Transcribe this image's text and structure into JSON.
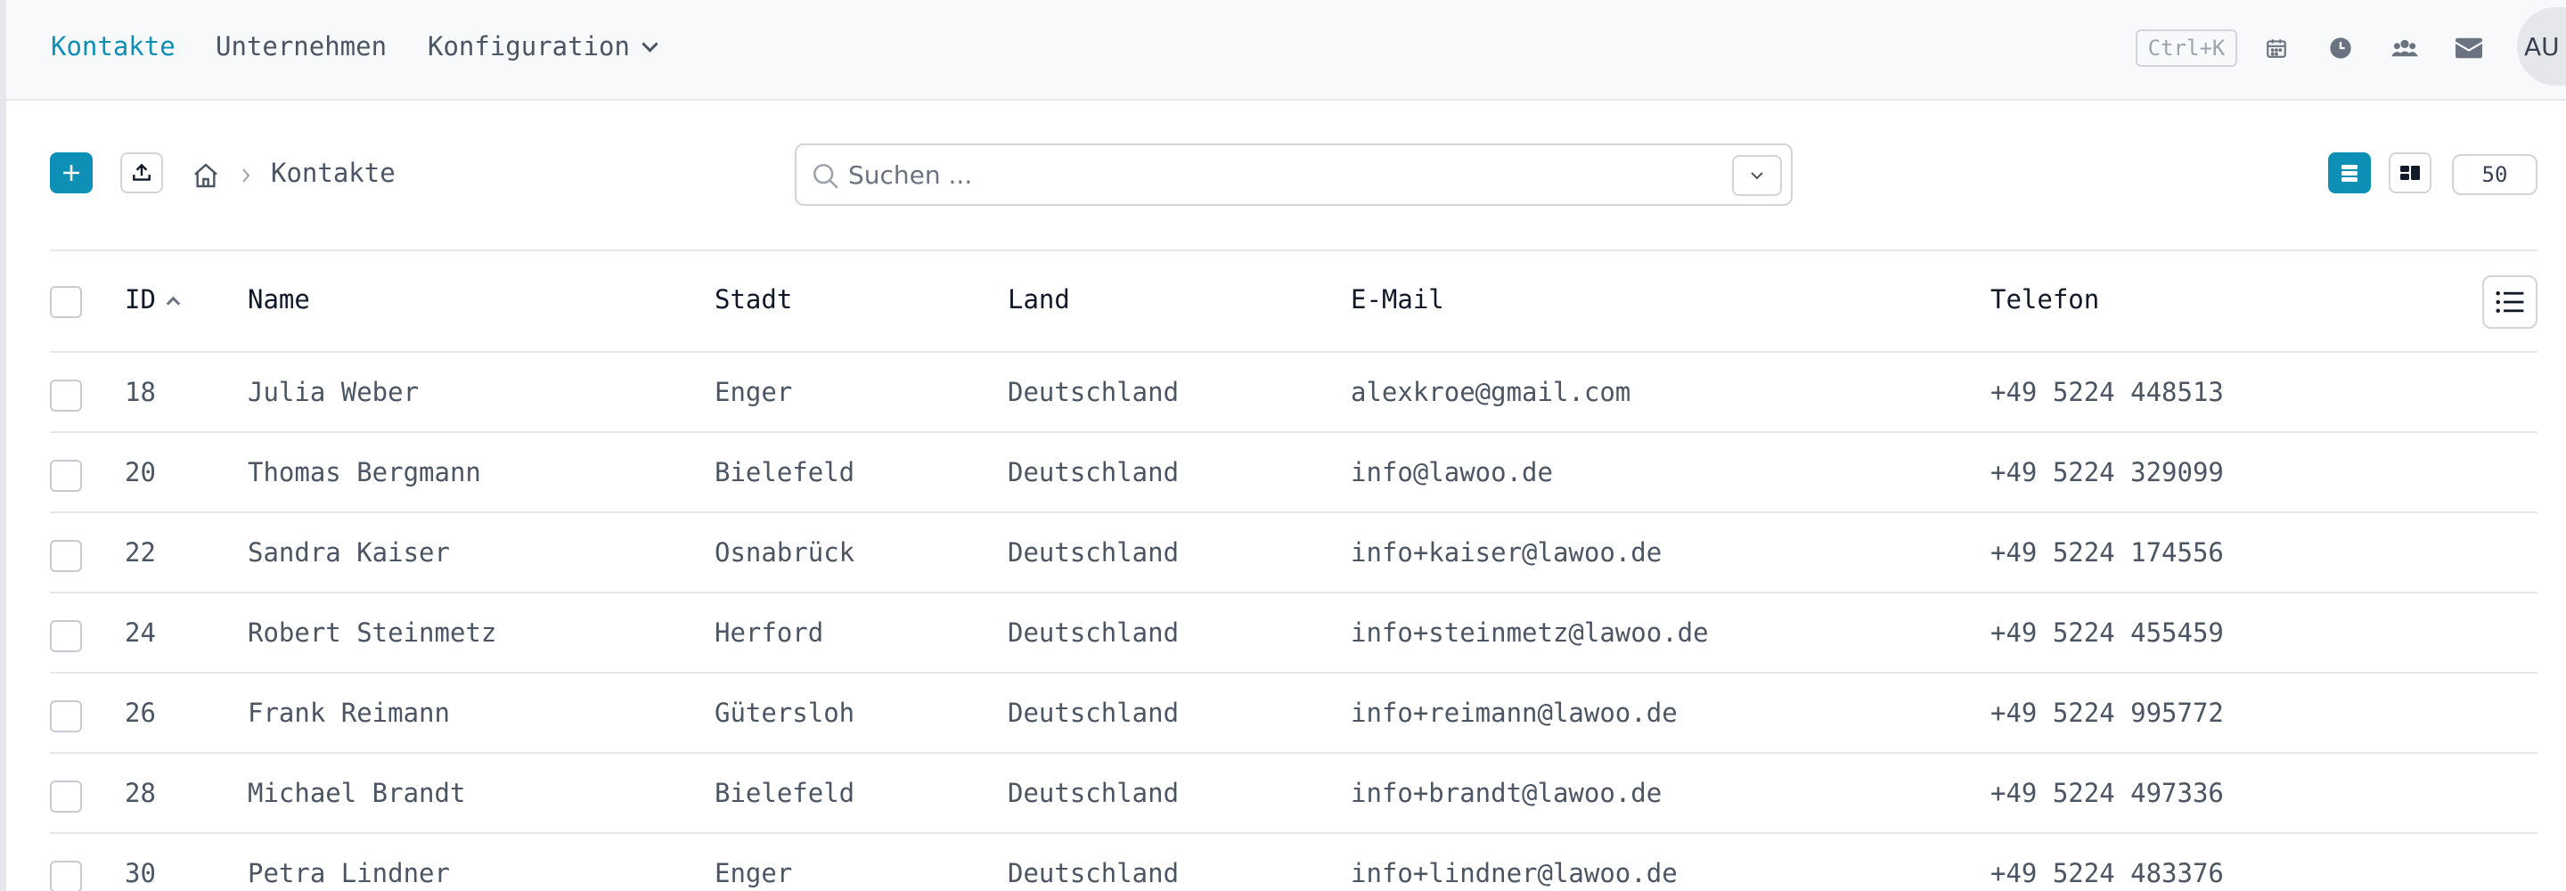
{
  "nav": {
    "items": [
      {
        "label": "Kontakte",
        "active": true
      },
      {
        "label": "Unternehmen",
        "active": false
      },
      {
        "label": "Konfiguration",
        "active": false,
        "dropdown": true
      }
    ],
    "shortcut": "Ctrl+K",
    "avatar": "AU",
    "icons": [
      "calendar-icon",
      "clock-icon",
      "users-icon",
      "mail-icon"
    ]
  },
  "toolbar": {
    "breadcrumb_label": "Kontakte",
    "search_placeholder": "Suchen ...",
    "page_size": "50"
  },
  "table": {
    "columns": {
      "id": "ID",
      "name": "Name",
      "city": "Stadt",
      "country": "Land",
      "email": "E-Mail",
      "phone": "Telefon"
    },
    "rows": [
      {
        "id": "18",
        "name": "Julia Weber",
        "city": "Enger",
        "country": "Deutschland",
        "email": "alexkroe@gmail.com",
        "phone": "+49 5224 448513"
      },
      {
        "id": "20",
        "name": "Thomas Bergmann",
        "city": "Bielefeld",
        "country": "Deutschland",
        "email": "info@lawoo.de",
        "phone": "+49 5224 329099"
      },
      {
        "id": "22",
        "name": "Sandra Kaiser",
        "city": "Osnabrück",
        "country": "Deutschland",
        "email": "info+kaiser@lawoo.de",
        "phone": "+49 5224 174556"
      },
      {
        "id": "24",
        "name": "Robert Steinmetz",
        "city": "Herford",
        "country": "Deutschland",
        "email": "info+steinmetz@lawoo.de",
        "phone": "+49 5224 455459"
      },
      {
        "id": "26",
        "name": "Frank Reimann",
        "city": "Gütersloh",
        "country": "Deutschland",
        "email": "info+reimann@lawoo.de",
        "phone": "+49 5224 995772"
      },
      {
        "id": "28",
        "name": "Michael Brandt",
        "city": "Bielefeld",
        "country": "Deutschland",
        "email": "info+brandt@lawoo.de",
        "phone": "+49 5224 497336"
      },
      {
        "id": "30",
        "name": "Petra Lindner",
        "city": "Enger",
        "country": "Deutschland",
        "email": "info+lindner@lawoo.de",
        "phone": "+49 5224 483376"
      }
    ]
  },
  "colors": {
    "accent": "#0e8fb6",
    "border": "#e5e7eb",
    "text": "#4b5563"
  }
}
